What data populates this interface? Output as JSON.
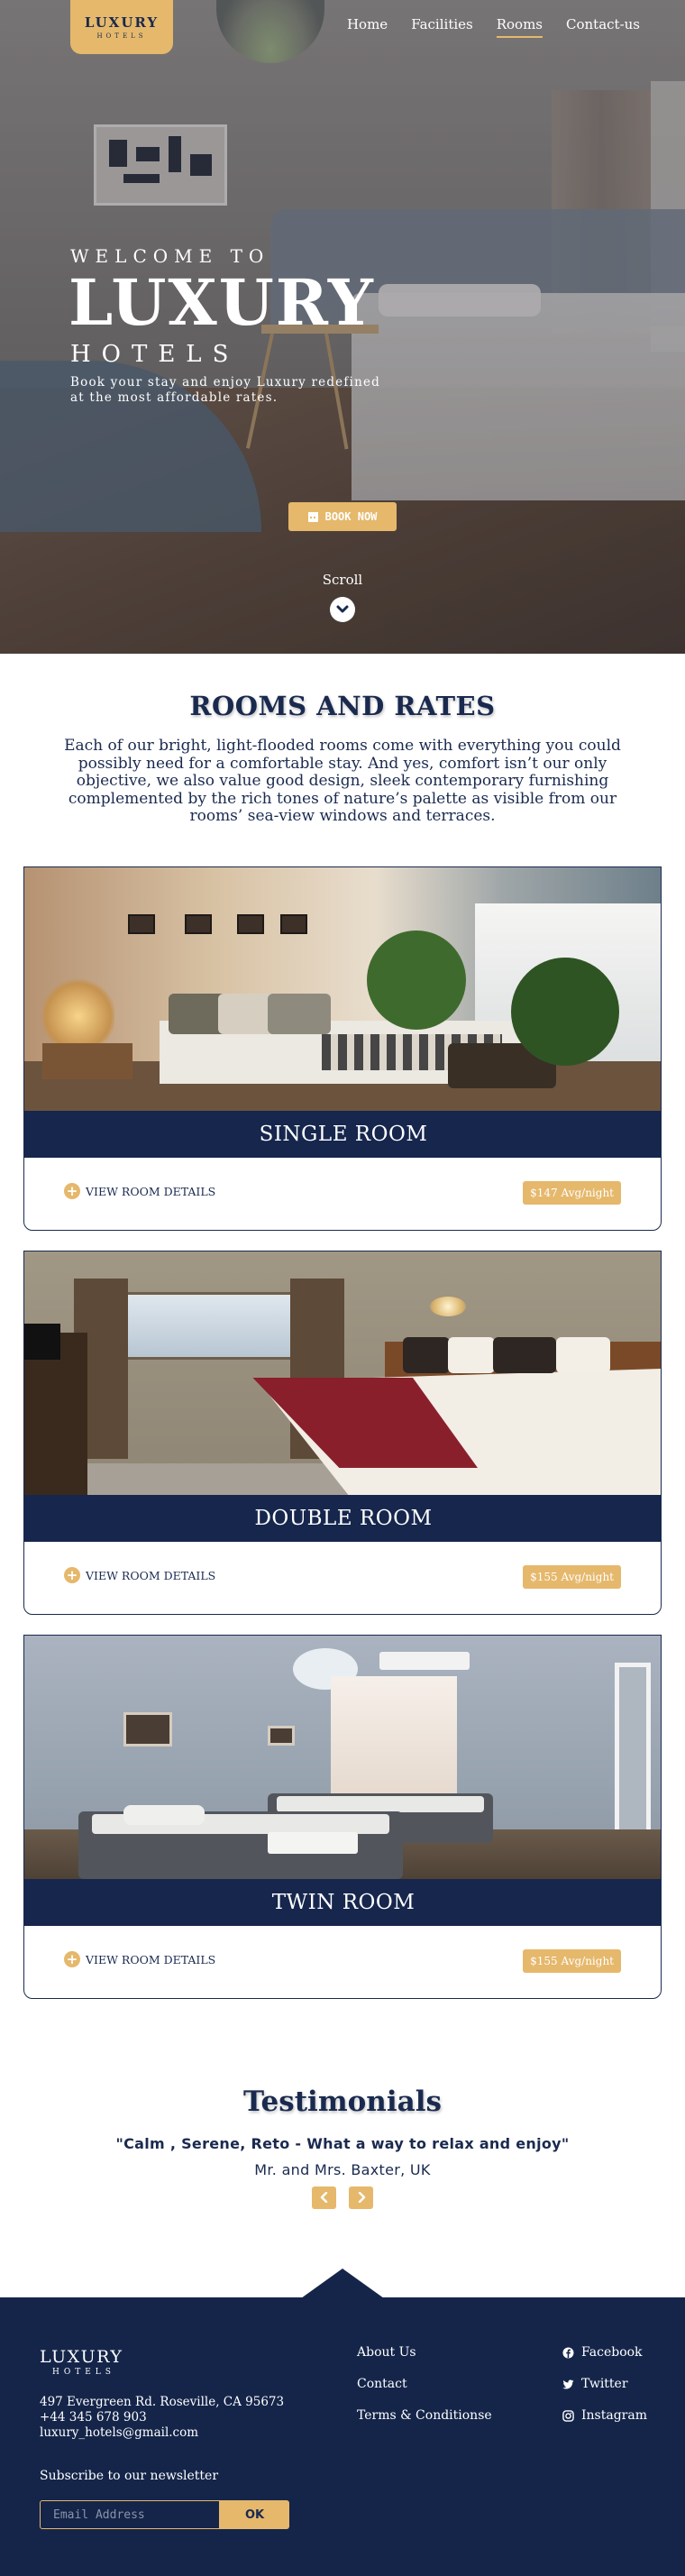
{
  "nav": {
    "logo_main": "LUXURY",
    "logo_sub": "HOTELS",
    "items": [
      {
        "label": "Home",
        "active": false
      },
      {
        "label": "Facilities",
        "active": false
      },
      {
        "label": "Rooms",
        "active": true
      },
      {
        "label": "Contact-us",
        "active": false
      }
    ]
  },
  "hero": {
    "welcome": "WELCOME TO",
    "title": "LUXURY",
    "subtitle": "HOTELS",
    "description": "Book your stay and enjoy Luxury redefined at the most affordable rates.",
    "book_button": "BOOK NOW",
    "book_icon": "calendar-icon",
    "scroll_label": "Scroll",
    "scroll_icon": "chevron-down-icon"
  },
  "rooms_section": {
    "title": "ROOMS AND RATES",
    "description": "Each of our bright, light-flooded rooms come with everything you could possibly need for a comfortable stay. And yes, comfort isn’t our only objective, we also value good design, sleek contemporary furnishing complemented by the rich tones of nature’s palette as visible from our rooms’ sea-view windows and terraces.",
    "rooms": [
      {
        "name": "SINGLE ROOM",
        "details_label": "VIEW ROOM DETAILS",
        "price": "$147 Avg/night"
      },
      {
        "name": "DOUBLE ROOM",
        "details_label": "VIEW ROOM DETAILS",
        "price": "$155 Avg/night"
      },
      {
        "name": "TWIN ROOM",
        "details_label": "VIEW ROOM DETAILS",
        "price": "$155 Avg/night"
      }
    ]
  },
  "testimonials": {
    "title": "Testimonials",
    "quote": "\"Calm , Serene, Reto - What a way to relax and enjoy\"",
    "author": "Mr. and Mrs. Baxter, UK",
    "prev_icon": "chevron-left-icon",
    "next_icon": "chevron-right-icon"
  },
  "footer": {
    "logo_main": "LUXURY",
    "logo_sub": "HOTELS",
    "address": "497 Evergreen Rd. Roseville, CA 95673",
    "phone": "+44 345 678 903",
    "email": "luxury_hotels@gmail.com",
    "links": [
      "About Us",
      "Contact",
      "Terms & Conditionse"
    ],
    "social": [
      {
        "label": "Facebook",
        "icon": "facebook-icon"
      },
      {
        "label": "Twitter",
        "icon": "twitter-icon"
      },
      {
        "label": "Instagram",
        "icon": "instagram-icon"
      }
    ],
    "newsletter_label": "Subscribe to our newsletter",
    "email_placeholder": "Email Address",
    "ok_button": "OK"
  },
  "colors": {
    "navy": "#15254a",
    "gold": "#e5b86c",
    "text": "#1a2a4f"
  }
}
